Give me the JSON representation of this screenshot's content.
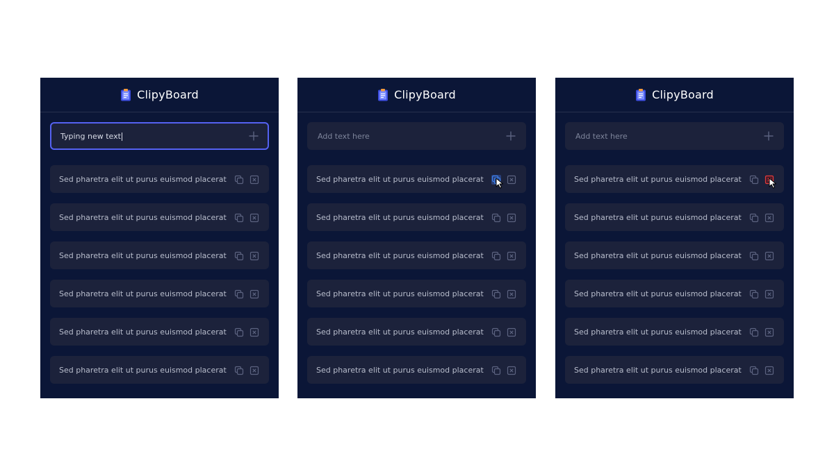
{
  "colors": {
    "panel_bg": "#0b1637",
    "field_bg": "#1c223b",
    "focus_border": "#5562f2",
    "copy_active": "#3b7fe8",
    "delete_active": "#e23b3b"
  },
  "panels": [
    {
      "title": "ClipyBoard",
      "logo_icon": "clipboard-icon",
      "input": {
        "value": "Typing new text",
        "placeholder": "Add text here",
        "focused": true
      },
      "items": [
        "Sed pharetra elit ut purus euismod placerat",
        "Sed pharetra elit ut purus euismod placerat",
        "Sed pharetra elit ut purus euismod placerat",
        "Sed pharetra elit ut purus euismod placerat",
        "Sed pharetra elit ut purus euismod placerat",
        "Sed pharetra elit ut purus euismod placerat"
      ],
      "hover": null
    },
    {
      "title": "ClipyBoard",
      "logo_icon": "clipboard-icon",
      "input": {
        "value": "",
        "placeholder": "Add text here",
        "focused": false
      },
      "items": [
        "Sed pharetra elit ut purus euismod placerat",
        "Sed pharetra elit ut purus euismod placerat",
        "Sed pharetra elit ut purus euismod placerat",
        "Sed pharetra elit ut purus euismod placerat",
        "Sed pharetra elit ut purus euismod placerat",
        "Sed pharetra elit ut purus euismod placerat"
      ],
      "hover": {
        "item": 0,
        "action": "copy"
      }
    },
    {
      "title": "ClipyBoard",
      "logo_icon": "clipboard-icon",
      "input": {
        "value": "",
        "placeholder": "Add text here",
        "focused": false
      },
      "items": [
        "Sed pharetra elit ut purus euismod placerat",
        "Sed pharetra elit ut purus euismod placerat",
        "Sed pharetra elit ut purus euismod placerat",
        "Sed pharetra elit ut purus euismod placerat",
        "Sed pharetra elit ut purus euismod placerat",
        "Sed pharetra elit ut purus euismod placerat"
      ],
      "hover": {
        "item": 0,
        "action": "delete"
      }
    }
  ]
}
